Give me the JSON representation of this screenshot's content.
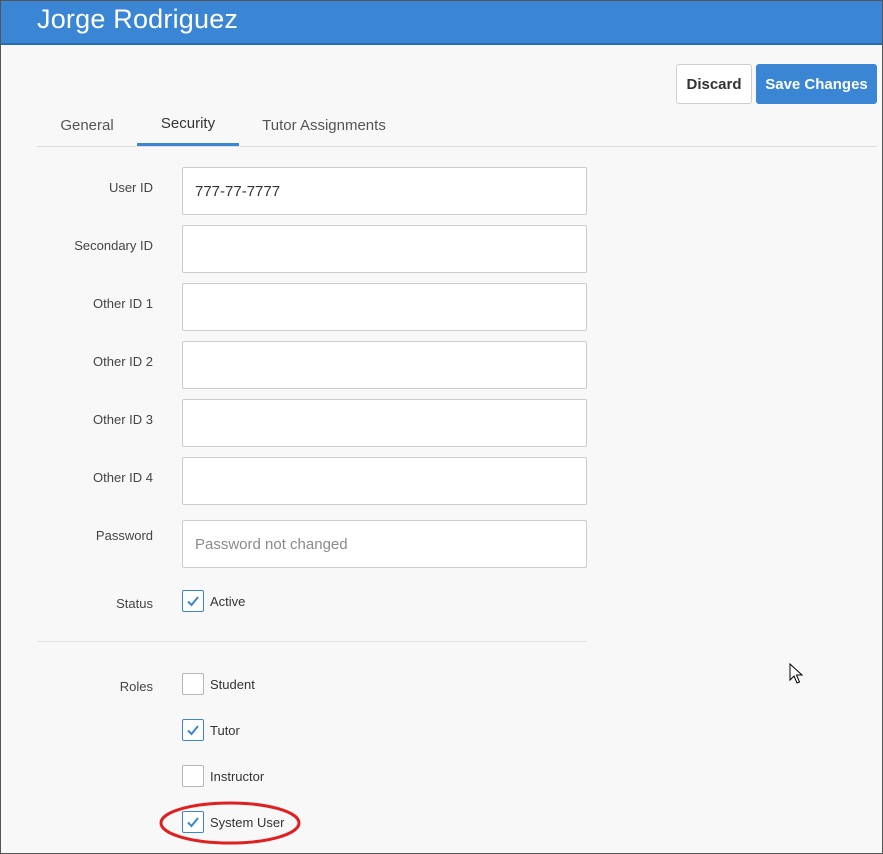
{
  "header": {
    "title": "Jorge Rodriguez"
  },
  "actions": {
    "discard_label": "Discard",
    "save_label": "Save Changes"
  },
  "tabs": [
    {
      "label": "General",
      "active": false
    },
    {
      "label": "Security",
      "active": true
    },
    {
      "label": "Tutor Assignments",
      "active": false
    }
  ],
  "form": {
    "user_id": {
      "label": "User ID",
      "value": "777-77-7777"
    },
    "secondary_id": {
      "label": "Secondary ID",
      "value": ""
    },
    "other_id_1": {
      "label": "Other ID 1",
      "value": ""
    },
    "other_id_2": {
      "label": "Other ID 2",
      "value": ""
    },
    "other_id_3": {
      "label": "Other ID 3",
      "value": ""
    },
    "other_id_4": {
      "label": "Other ID 4",
      "value": ""
    },
    "password": {
      "label": "Password",
      "value": "",
      "placeholder": "Password not changed"
    },
    "status": {
      "label": "Status",
      "option": "Active",
      "checked": true
    },
    "roles": {
      "label": "Roles",
      "options": [
        {
          "label": "Student",
          "checked": false
        },
        {
          "label": "Tutor",
          "checked": true
        },
        {
          "label": "Instructor",
          "checked": false
        },
        {
          "label": "System User",
          "checked": true
        }
      ]
    }
  },
  "colors": {
    "accent": "#3a86d4",
    "annotation": "#e02020"
  },
  "icons": {
    "check": "checkmark-icon",
    "cursor": "mouse-pointer-icon"
  }
}
